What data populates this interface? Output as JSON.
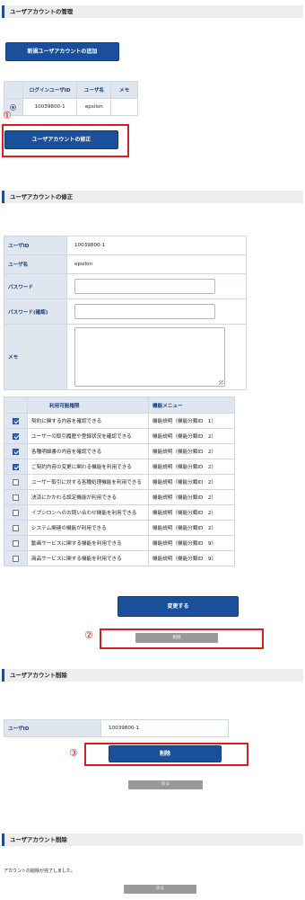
{
  "section1": {
    "header": "ユーザアカウントの管理",
    "add_button": "新規ユーザアカウントの追加",
    "table_headers": [
      "ログインユーザID",
      "ユーザ名",
      "メモ"
    ],
    "rows": [
      {
        "selected": true,
        "login_id": "10039800-1",
        "user_name": "epsilon",
        "memo": ""
      }
    ],
    "modify_button": "ユーザアカウントの修正",
    "marker": "①"
  },
  "section2": {
    "header": "ユーザアカウントの修正",
    "fields": {
      "user_id_label": "ユーザID",
      "user_id_value": "10039800-1",
      "user_name_label": "ユーザ名",
      "user_name_value": "epsilon",
      "password_label": "パスワード",
      "password_confirm_label": "パスワード(確認)",
      "memo_label": "メモ"
    },
    "perm_headers": [
      "利用可能権限",
      "機能メニュー"
    ],
    "permissions": [
      {
        "checked": true,
        "label": "契約に関する内容を確認できる",
        "menu": "機能説明（機能分類ID　1）"
      },
      {
        "checked": true,
        "label": "ユーザーの取引履歴や登録状況を確認できる",
        "menu": "機能説明（機能分類ID　2）"
      },
      {
        "checked": true,
        "label": "各種明細書の内容を確認できる",
        "menu": "機能説明（機能分類ID　2）"
      },
      {
        "checked": true,
        "label": "ご契約内容の変更に関わる機能を利用できる",
        "menu": "機能説明（機能分類ID　2）"
      },
      {
        "checked": false,
        "label": "ユーザー取引に対する各種処理機能を利用できる",
        "menu": "機能説明（機能分類ID　2）"
      },
      {
        "checked": false,
        "label": "決済にかかわる設定機能が利用できる",
        "menu": "機能説明（機能分類ID　2）"
      },
      {
        "checked": false,
        "label": "イプシロンへのお問い合わせ機能を利用できる",
        "menu": "機能説明（機能分類ID　2）"
      },
      {
        "checked": false,
        "label": "システム関連の機能が利用できる",
        "menu": "機能説明（機能分類ID　2）"
      },
      {
        "checked": false,
        "label": "動画サービスに関する機能を利用できる",
        "menu": "機能説明（機能分類ID　9）"
      },
      {
        "checked": false,
        "label": "商品サービスに関する機能を利用できる",
        "menu": "機能説明（機能分類ID　9）"
      }
    ],
    "change_button": "変更する",
    "delete_button": "削除",
    "marker": "②"
  },
  "section3": {
    "header": "ユーザアカウント削除",
    "user_id_label": "ユーザID",
    "user_id_value": "10039800-1",
    "delete_button": "削除",
    "back_button": "戻る",
    "marker": "③"
  },
  "section4": {
    "header": "ユーザアカウント削除",
    "message": "アカウントの削除が完了しました。",
    "back_button": "戻る"
  },
  "colors": {
    "accent": "#1a4f9c",
    "highlight": "#d62020",
    "header_bg": "#dfe6f0"
  }
}
